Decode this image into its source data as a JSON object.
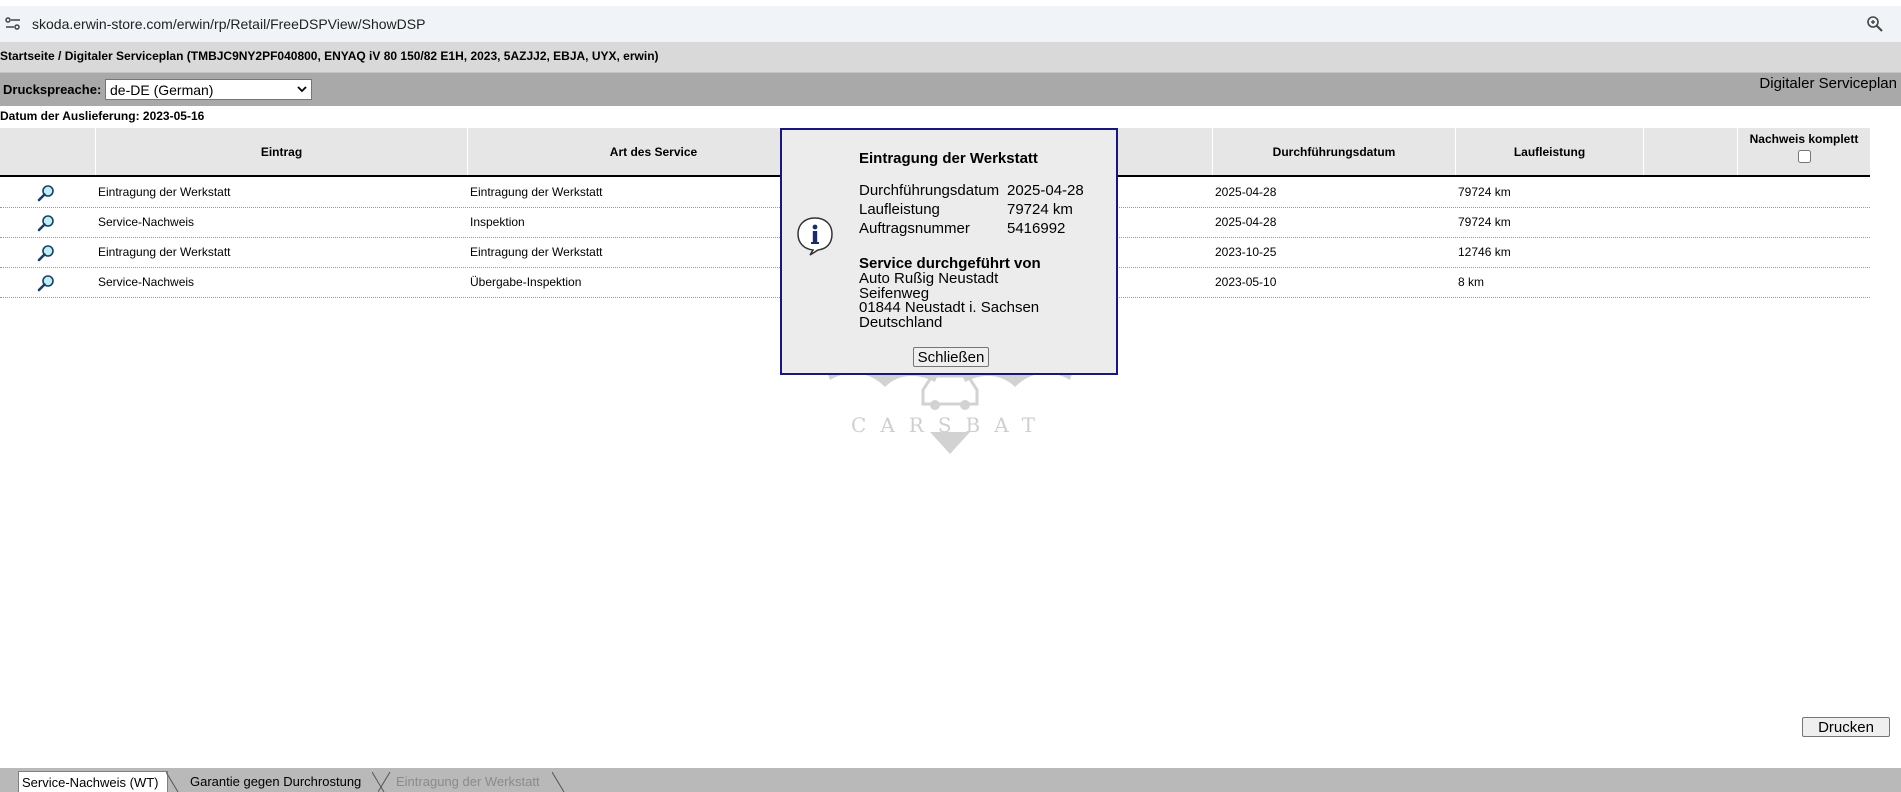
{
  "browser": {
    "url": "skoda.erwin-store.com/erwin/rp/Retail/FreeDSPView/ShowDSP",
    "site_icon": "site-settings-icon",
    "zoom_icon": "zoom-icon"
  },
  "breadcrumb": "Startseite / Digitaler Serviceplan (TMBJC9NY2PF040800, ENYAQ iV 80 150/82 E1H, 2023, 5AZJJ2, EBJA, UYX, erwin)",
  "language": {
    "label": "Druckspreache:",
    "selected": "de-DE (German)"
  },
  "page_title": "Digitaler Serviceplan",
  "delivery_date": "Datum der Auslieferung: 2023-05-16",
  "table": {
    "headers": {
      "eintrag": "Eintrag",
      "art": "Art des Service",
      "datum": "Durchführungsdatum",
      "laufleistung": "Laufleistung",
      "nachweis": "Nachweis komplett"
    },
    "rows": [
      {
        "eintrag": "Eintragung der Werkstatt",
        "art": "Eintragung der Werkstatt",
        "datum": "2025-04-28",
        "laufleistung": "79724 km"
      },
      {
        "eintrag": "Service-Nachweis",
        "art": "Inspektion",
        "datum": "2025-04-28",
        "laufleistung": "79724 km"
      },
      {
        "eintrag": "Eintragung der Werkstatt",
        "art": "Eintragung der Werkstatt",
        "datum": "2023-10-25",
        "laufleistung": "12746 km"
      },
      {
        "eintrag": "Service-Nachweis",
        "art": "Übergabe-Inspektion",
        "datum": "2023-05-10",
        "laufleistung": "8 km"
      }
    ]
  },
  "dialog": {
    "title": "Eintragung der Werkstatt",
    "fields": [
      {
        "label": "Durchführungsdatum",
        "value": "2025-04-28"
      },
      {
        "label": "Laufleistung",
        "value": "79724 km"
      },
      {
        "label": "Auftragsnummer",
        "value": "5416992"
      }
    ],
    "service_heading": "Service durchgeführt von",
    "address": [
      "Auto Rußig Neustadt",
      "Seifenweg",
      "01844 Neustadt i. Sachsen",
      "Deutschland"
    ],
    "close_label": "Schließen"
  },
  "watermark": "CARSBAT",
  "print_label": "Drucken",
  "tabs": [
    {
      "label": "Service-Nachweis (WT)",
      "active": true
    },
    {
      "label": "Garantie gegen Durchrostung",
      "active": false
    },
    {
      "label": "Eintragung der Werkstatt",
      "active": false
    }
  ]
}
